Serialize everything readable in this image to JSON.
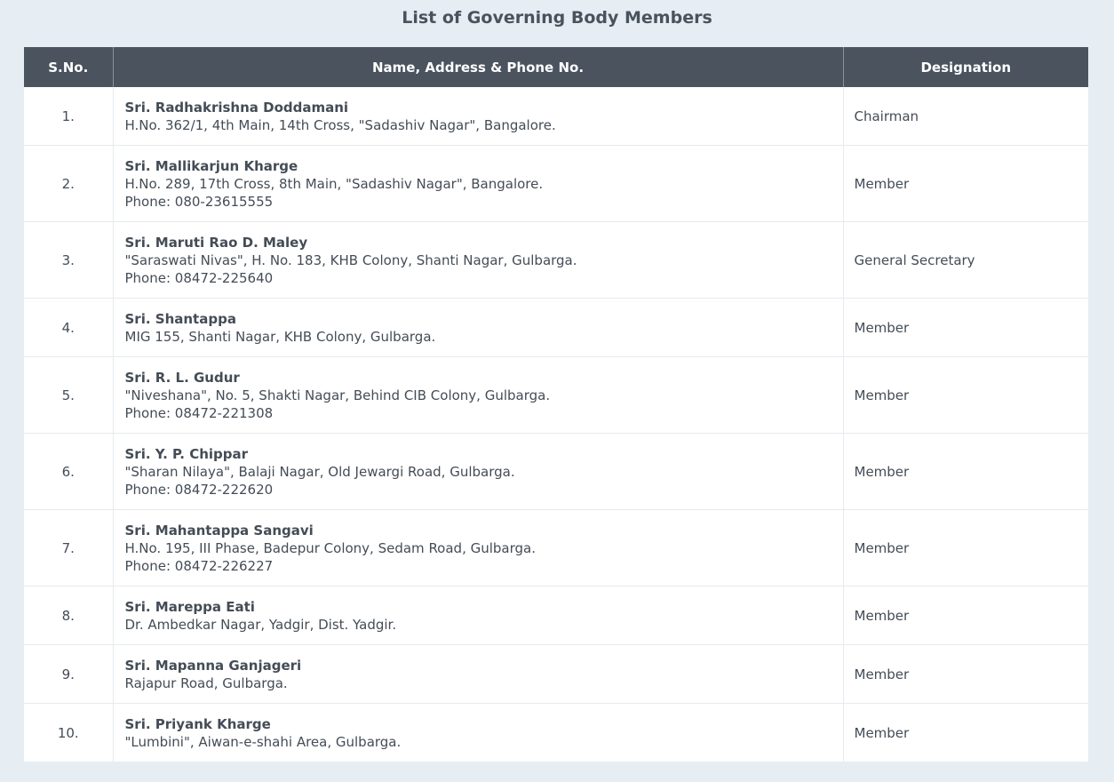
{
  "page": {
    "title": "List of Governing Body Members"
  },
  "table": {
    "headers": {
      "sno": "S.No.",
      "name": "Name, Address & Phone No.",
      "designation": "Designation"
    },
    "rows": [
      {
        "sno": "1.",
        "name": "Sri. Radhakrishna Doddamani",
        "address": "H.No. 362/1, 4th Main, 14th Cross, \"Sadashiv Nagar\", Bangalore.",
        "phone": "",
        "designation": "Chairman"
      },
      {
        "sno": "2.",
        "name": "Sri. Mallikarjun Kharge",
        "address": "H.No. 289, 17th Cross, 8th Main, \"Sadashiv Nagar\", Bangalore.",
        "phone": "Phone: 080-23615555",
        "designation": "Member"
      },
      {
        "sno": "3.",
        "name": "Sri. Maruti Rao D. Maley",
        "address": "\"Saraswati Nivas\", H. No. 183, KHB Colony, Shanti Nagar, Gulbarga.",
        "phone": "Phone: 08472-225640",
        "designation": "General Secretary"
      },
      {
        "sno": "4.",
        "name": "Sri. Shantappa",
        "address": "MIG 155, Shanti Nagar, KHB Colony, Gulbarga.",
        "phone": "",
        "designation": "Member"
      },
      {
        "sno": "5.",
        "name": "Sri. R. L. Gudur",
        "address": "\"Niveshana\", No. 5, Shakti Nagar, Behind CIB Colony, Gulbarga.",
        "phone": "Phone: 08472-221308",
        "designation": "Member"
      },
      {
        "sno": "6.",
        "name": "Sri. Y. P. Chippar",
        "address": "\"Sharan Nilaya\", Balaji Nagar, Old Jewargi Road, Gulbarga.",
        "phone": "Phone: 08472-222620",
        "designation": "Member"
      },
      {
        "sno": "7.",
        "name": "Sri. Mahantappa Sangavi",
        "address": "H.No. 195, III Phase, Badepur Colony, Sedam Road, Gulbarga.",
        "phone": "Phone: 08472-226227",
        "designation": "Member"
      },
      {
        "sno": "8.",
        "name": "Sri. Mareppa Eati",
        "address": "Dr. Ambedkar Nagar, Yadgir, Dist. Yadgir.",
        "phone": "",
        "designation": "Member"
      },
      {
        "sno": "9.",
        "name": "Sri. Mapanna Ganjageri",
        "address": "Rajapur Road, Gulbarga.",
        "phone": "",
        "designation": "Member"
      },
      {
        "sno": "10.",
        "name": "Sri. Priyank Kharge",
        "address": "\"Lumbini\", Aiwan-e-shahi Area, Gulbarga.",
        "phone": "",
        "designation": "Member"
      }
    ]
  },
  "colors": {
    "page_background": "#e6eef4",
    "header_background": "#4a535e",
    "header_text": "#ffffff",
    "body_text": "#444c56"
  }
}
